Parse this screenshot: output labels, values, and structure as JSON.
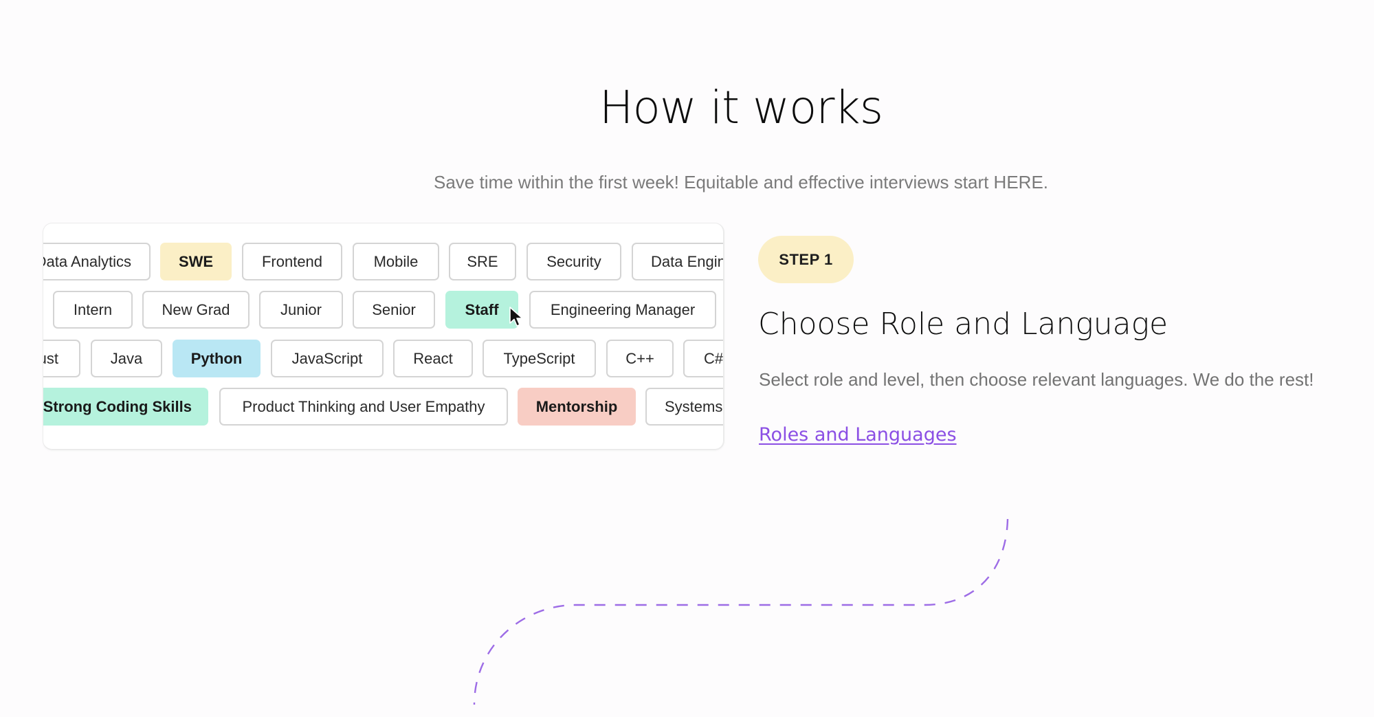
{
  "section": {
    "title": "How it works",
    "subtitle": "Save time within the first week! Equitable and effective interviews start HERE."
  },
  "chip_panel": {
    "rows": [
      {
        "name": "roles",
        "chips": [
          {
            "label": "Data Analytics",
            "selected": false
          },
          {
            "label": "SWE",
            "selected": true,
            "color": "#fbefc6"
          },
          {
            "label": "Frontend",
            "selected": false
          },
          {
            "label": "Mobile",
            "selected": false
          },
          {
            "label": "SRE",
            "selected": false
          },
          {
            "label": "Security",
            "selected": false
          },
          {
            "label": "Data Engineering",
            "selected": false
          }
        ]
      },
      {
        "name": "levels",
        "chips": [
          {
            "label": "Intern",
            "selected": false
          },
          {
            "label": "New Grad",
            "selected": false
          },
          {
            "label": "Junior",
            "selected": false
          },
          {
            "label": "Senior",
            "selected": false
          },
          {
            "label": "Staff",
            "selected": true,
            "color": "#b5f2dd"
          },
          {
            "label": "Engineering Manager",
            "selected": false
          }
        ]
      },
      {
        "name": "languages",
        "chips": [
          {
            "label": "Rust",
            "selected": false
          },
          {
            "label": "Java",
            "selected": false
          },
          {
            "label": "Python",
            "selected": true,
            "color": "#b9e7f4"
          },
          {
            "label": "JavaScript",
            "selected": false
          },
          {
            "label": "React",
            "selected": false
          },
          {
            "label": "TypeScript",
            "selected": false
          },
          {
            "label": "C++",
            "selected": false
          },
          {
            "label": "C#",
            "selected": false
          }
        ]
      },
      {
        "name": "skills",
        "chips": [
          {
            "label": "Strong Coding Skills",
            "selected": true,
            "color": "#b5f2dd"
          },
          {
            "label": "Product Thinking and User Empathy",
            "selected": false
          },
          {
            "label": "Mentorship",
            "selected": true,
            "color": "#f8cdc4"
          },
          {
            "label": "Systems",
            "selected": false
          }
        ]
      }
    ]
  },
  "step": {
    "badge": "STEP 1",
    "heading": "Choose Role and Language",
    "description": "Select role and level, then choose relevant languages. We do the rest!",
    "link_label": "Roles and Languages"
  },
  "colors": {
    "accent": "#8b4fe4",
    "step_badge": "#fbefc6"
  },
  "icons": {
    "cursor": "mouse-pointer-icon"
  }
}
